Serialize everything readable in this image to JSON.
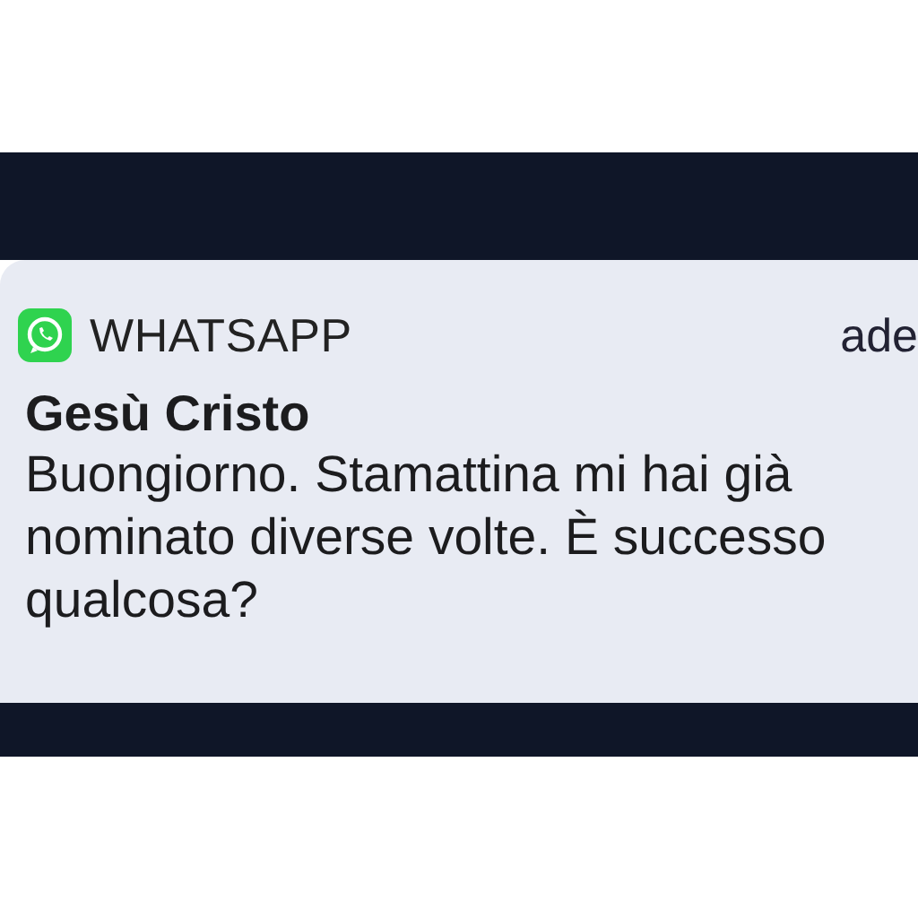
{
  "notification": {
    "app_name": "WHATSAPP",
    "time": "ade",
    "title": "Gesù Cristo",
    "message": "Buongiorno. Stamattina mi hai già nominato diverse volte. È successo qualcosa?"
  }
}
